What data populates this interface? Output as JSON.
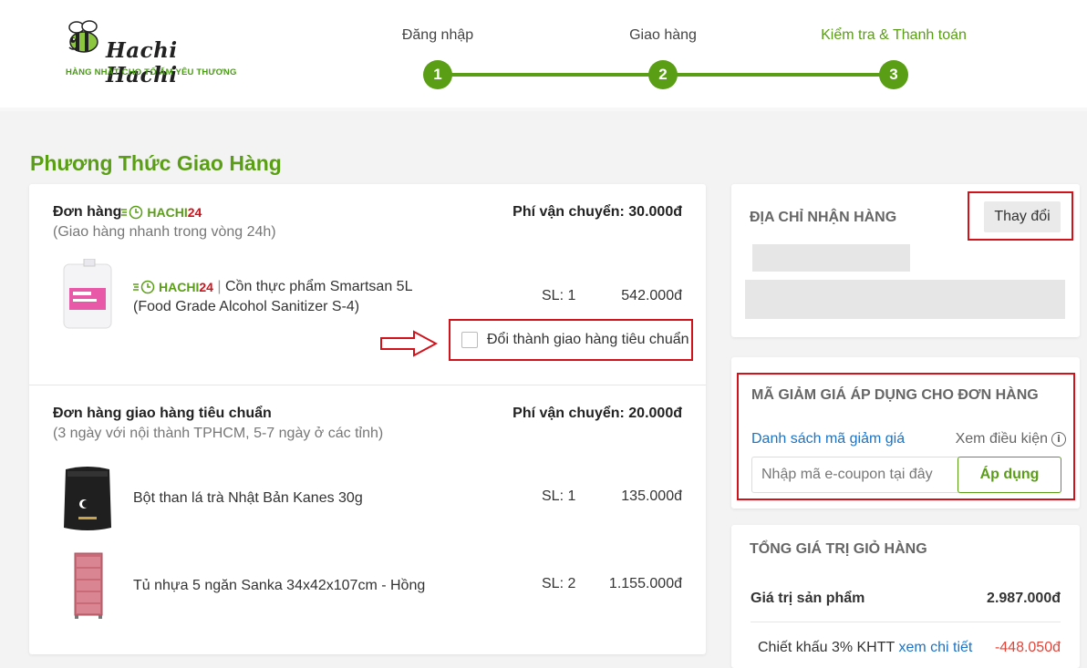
{
  "logo": {
    "brand": "Hachi Hachi",
    "tagline": "HÀNG NHẬT CHO TỔ ẤM YÊU THƯƠNG"
  },
  "steps": [
    {
      "label": "Đăng nhập",
      "num": "1"
    },
    {
      "label": "Giao hàng",
      "num": "2"
    },
    {
      "label": "Kiểm tra & Thanh toán",
      "num": "3"
    }
  ],
  "section_title": "Phương Thức Giao Hàng",
  "hachi24": {
    "prefix": "HACHI",
    "suffix": "24"
  },
  "orders": [
    {
      "title": "Đơn hàng",
      "subtitle": "(Giao hàng nhanh trong vòng 24h)",
      "fee": "Phí vận chuyển: 30.000đ",
      "items": [
        {
          "name_line1": "Cồn thực phẩm Smartsan 5L",
          "name_line2": "(Food Grade Alcohol Sanitizer S-4)",
          "qty": "SL: 1",
          "price": "542.000đ"
        }
      ],
      "switch_label": "Đổi thành giao hàng tiêu chuẩn"
    },
    {
      "title": "Đơn hàng giao hàng tiêu chuẩn",
      "subtitle": "(3 ngày với nội thành TPHCM, 5-7 ngày ở các tỉnh)",
      "fee": "Phí vận chuyển: 20.000đ",
      "items": [
        {
          "name": "Bột than lá trà Nhật Bản Kanes 30g",
          "qty": "SL: 1",
          "price": "135.000đ"
        },
        {
          "name": "Tủ nhựa 5 ngăn Sanka 34x42x107cm - Hồng",
          "qty": "SL: 2",
          "price": "1.155.000đ"
        }
      ]
    }
  ],
  "address": {
    "title": "ĐỊA CHỈ NHẬN HÀNG",
    "change_label": "Thay đổi"
  },
  "coupon": {
    "title": "MÃ GIẢM GIÁ ÁP DỤNG CHO ĐƠN HÀNG",
    "list_link": "Danh sách mã giảm giá",
    "conditions": "Xem điều kiện",
    "placeholder": "Nhập mã e-coupon tại đây",
    "apply_label": "Áp dụng"
  },
  "summary": {
    "title": "TỔNG GIÁ TRỊ GIỎ HÀNG",
    "product_value_label": "Giá trị sản phẩm",
    "product_value": "2.987.000đ",
    "discount_label": "Chiết khấu 3% KHTT",
    "discount_link": "xem chi tiết",
    "discount_value": "-448.050đ"
  },
  "colors": {
    "brand_green": "#5a9e16",
    "highlight_red": "#d0121b",
    "link_blue": "#1a73c7",
    "negative": "#e2463b"
  }
}
